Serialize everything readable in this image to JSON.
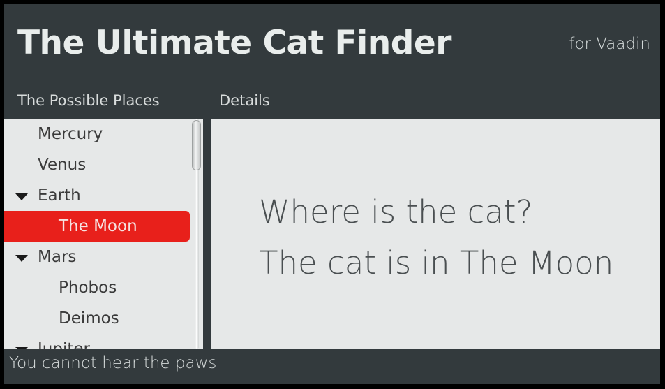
{
  "header": {
    "title": "The Ultimate Cat Finder",
    "subtitle": "for Vaadin",
    "background_color": "#333a3d",
    "title_color": "#e9edec"
  },
  "tabs": [
    {
      "label": "The Possible Places",
      "selected": true
    },
    {
      "label": "Details",
      "selected": false
    }
  ],
  "tree": {
    "panel_background": "#e6e8e8",
    "selection_color": "#e8201b",
    "items": [
      {
        "label": "Mercury",
        "level": 0,
        "expandable": false,
        "expanded": false,
        "selected": false
      },
      {
        "label": "Venus",
        "level": 0,
        "expandable": false,
        "expanded": false,
        "selected": false
      },
      {
        "label": "Earth",
        "level": 0,
        "expandable": true,
        "expanded": true,
        "selected": false
      },
      {
        "label": "The Moon",
        "level": 1,
        "expandable": false,
        "expanded": false,
        "selected": true
      },
      {
        "label": "Mars",
        "level": 0,
        "expandable": true,
        "expanded": true,
        "selected": false
      },
      {
        "label": "Phobos",
        "level": 1,
        "expandable": false,
        "expanded": false,
        "selected": false
      },
      {
        "label": "Deimos",
        "level": 1,
        "expandable": false,
        "expanded": false,
        "selected": false
      },
      {
        "label": "Jupiter",
        "level": 0,
        "expandable": true,
        "expanded": true,
        "selected": false
      }
    ],
    "scrollbar": {
      "thumb_position": "top"
    }
  },
  "details": {
    "background": "#e6e8e8",
    "lines": [
      "Where is the cat?",
      "The cat is in The Moon"
    ]
  },
  "statusbar": {
    "text": "You cannot hear the paws"
  }
}
